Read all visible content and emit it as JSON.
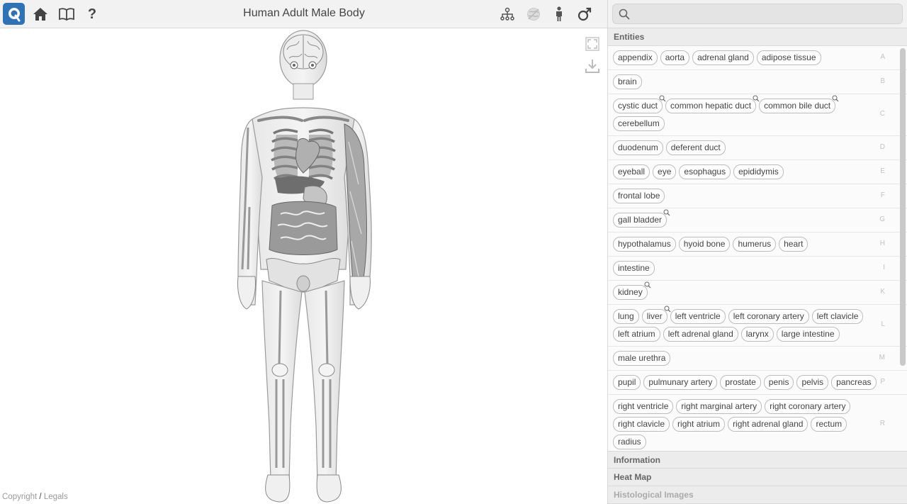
{
  "header": {
    "title": "Human Adult Male Body"
  },
  "search": {
    "placeholder": "",
    "value": ""
  },
  "icons": {
    "logo": "search-logo-icon",
    "home": "home-icon",
    "book": "book-icon",
    "help": "help-icon",
    "hierarchy": "hierarchy-icon",
    "globe": "globe-icon",
    "person": "person-icon",
    "male": "male-icon"
  },
  "colors": {
    "accent": "#2e73b8"
  },
  "panel": {
    "entities_label": "Entities",
    "information_label": "Information",
    "heatmap_label": "Heat Map",
    "histology_label": "Histological Images",
    "groups": [
      {
        "letter": "A",
        "items": [
          "appendix",
          "aorta",
          "adrenal gland",
          "adipose tissue"
        ],
        "searchable": []
      },
      {
        "letter": "B",
        "items": [
          "brain"
        ],
        "searchable": []
      },
      {
        "letter": "C",
        "items": [
          "cystic duct",
          "common hepatic duct",
          "common bile duct",
          "cerebellum"
        ],
        "searchable": [
          0,
          1,
          2
        ]
      },
      {
        "letter": "D",
        "items": [
          "duodenum",
          "deferent duct"
        ],
        "searchable": []
      },
      {
        "letter": "E",
        "items": [
          "eyeball",
          "eye",
          "esophagus",
          "epididymis"
        ],
        "searchable": []
      },
      {
        "letter": "F",
        "items": [
          "frontal lobe"
        ],
        "searchable": []
      },
      {
        "letter": "G",
        "items": [
          "gall bladder"
        ],
        "searchable": [
          0
        ]
      },
      {
        "letter": "H",
        "items": [
          "hypothalamus",
          "hyoid bone",
          "humerus",
          "heart"
        ],
        "searchable": []
      },
      {
        "letter": "I",
        "items": [
          "intestine"
        ],
        "searchable": []
      },
      {
        "letter": "K",
        "items": [
          "kidney"
        ],
        "searchable": [
          0
        ]
      },
      {
        "letter": "L",
        "items": [
          "lung",
          "liver",
          "left ventricle",
          "left coronary artery",
          "left clavicle",
          "left atrium",
          "left adrenal gland",
          "larynx",
          "large intestine"
        ],
        "searchable": [
          1
        ]
      },
      {
        "letter": "M",
        "items": [
          "male urethra"
        ],
        "searchable": []
      },
      {
        "letter": "P",
        "items": [
          "pupil",
          "pulmunary artery",
          "prostate",
          "penis",
          "pelvis",
          "pancreas"
        ],
        "searchable": []
      },
      {
        "letter": "R",
        "items": [
          "right ventricle",
          "right marginal artery",
          "right coronary artery",
          "right clavicle",
          "right atrium",
          "right adrenal gland",
          "rectum",
          "radius"
        ],
        "searchable": []
      }
    ]
  },
  "footer": {
    "copyright": "Copyright",
    "separator": "/",
    "legals": "Legals"
  }
}
